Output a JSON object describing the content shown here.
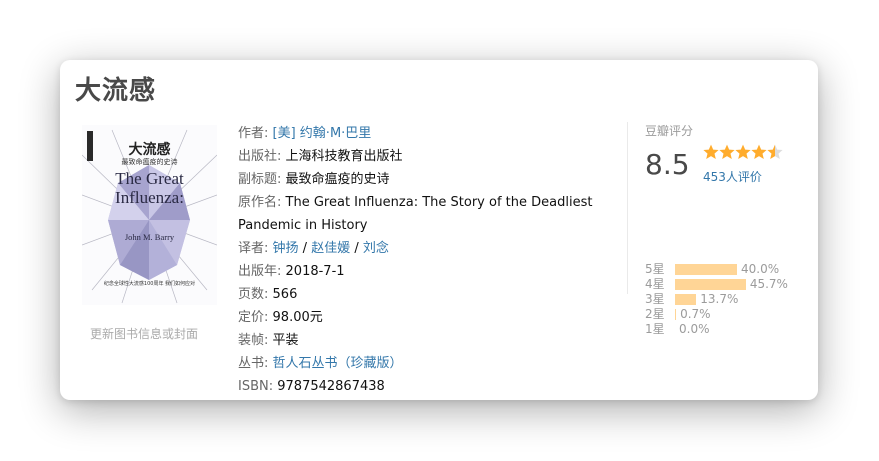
{
  "book": {
    "title": "大流感",
    "update_link": "更新图书信息或封面"
  },
  "cover": {
    "cn_title": "大流感",
    "cn_subtitle": "最致命瘟疫的史诗",
    "en_title_1": "The Great",
    "en_title_2": "Influenza:",
    "author": "John M. Barry",
    "tagline": "纪念全球性大流感100周年 我们如何应对"
  },
  "info": {
    "author_label": "作者:",
    "author_value": "[美] 约翰·M·巴里",
    "publisher_label": "出版社:",
    "publisher_value": "上海科技教育出版社",
    "subtitle_label": "副标题:",
    "subtitle_value": "最致命瘟疫的史诗",
    "original_label": "原作名:",
    "original_value": "The Great Influenza: The Story of the Deadliest Pandemic in History",
    "translator_label": "译者:",
    "translators": [
      "钟扬",
      "赵佳媛",
      "刘念"
    ],
    "separator": " / ",
    "pubdate_label": "出版年:",
    "pubdate_value": "2018-7-1",
    "pages_label": "页数:",
    "pages_value": "566",
    "price_label": "定价:",
    "price_value": "98.00元",
    "binding_label": "装帧:",
    "binding_value": "平装",
    "series_label": "丛书:",
    "series_value": "哲人石丛书（珍藏版）",
    "isbn_label": "ISBN:",
    "isbn_value": "9787542867438"
  },
  "rating": {
    "title": "豆瓣评分",
    "score": "8.5",
    "stars": 4.5,
    "count": "453人评价",
    "bars": [
      {
        "label": "5星",
        "pct": 40.0,
        "text": "40.0%"
      },
      {
        "label": "4星",
        "pct": 45.7,
        "text": "45.7%"
      },
      {
        "label": "3星",
        "pct": 13.7,
        "text": "13.7%"
      },
      {
        "label": "2星",
        "pct": 0.7,
        "text": "0.7%"
      },
      {
        "label": "1星",
        "pct": 0.0,
        "text": "0.0%"
      }
    ]
  },
  "colors": {
    "link": "#3377aa",
    "star": "#ffac2d",
    "bar": "#ffd596",
    "label": "#666666"
  }
}
